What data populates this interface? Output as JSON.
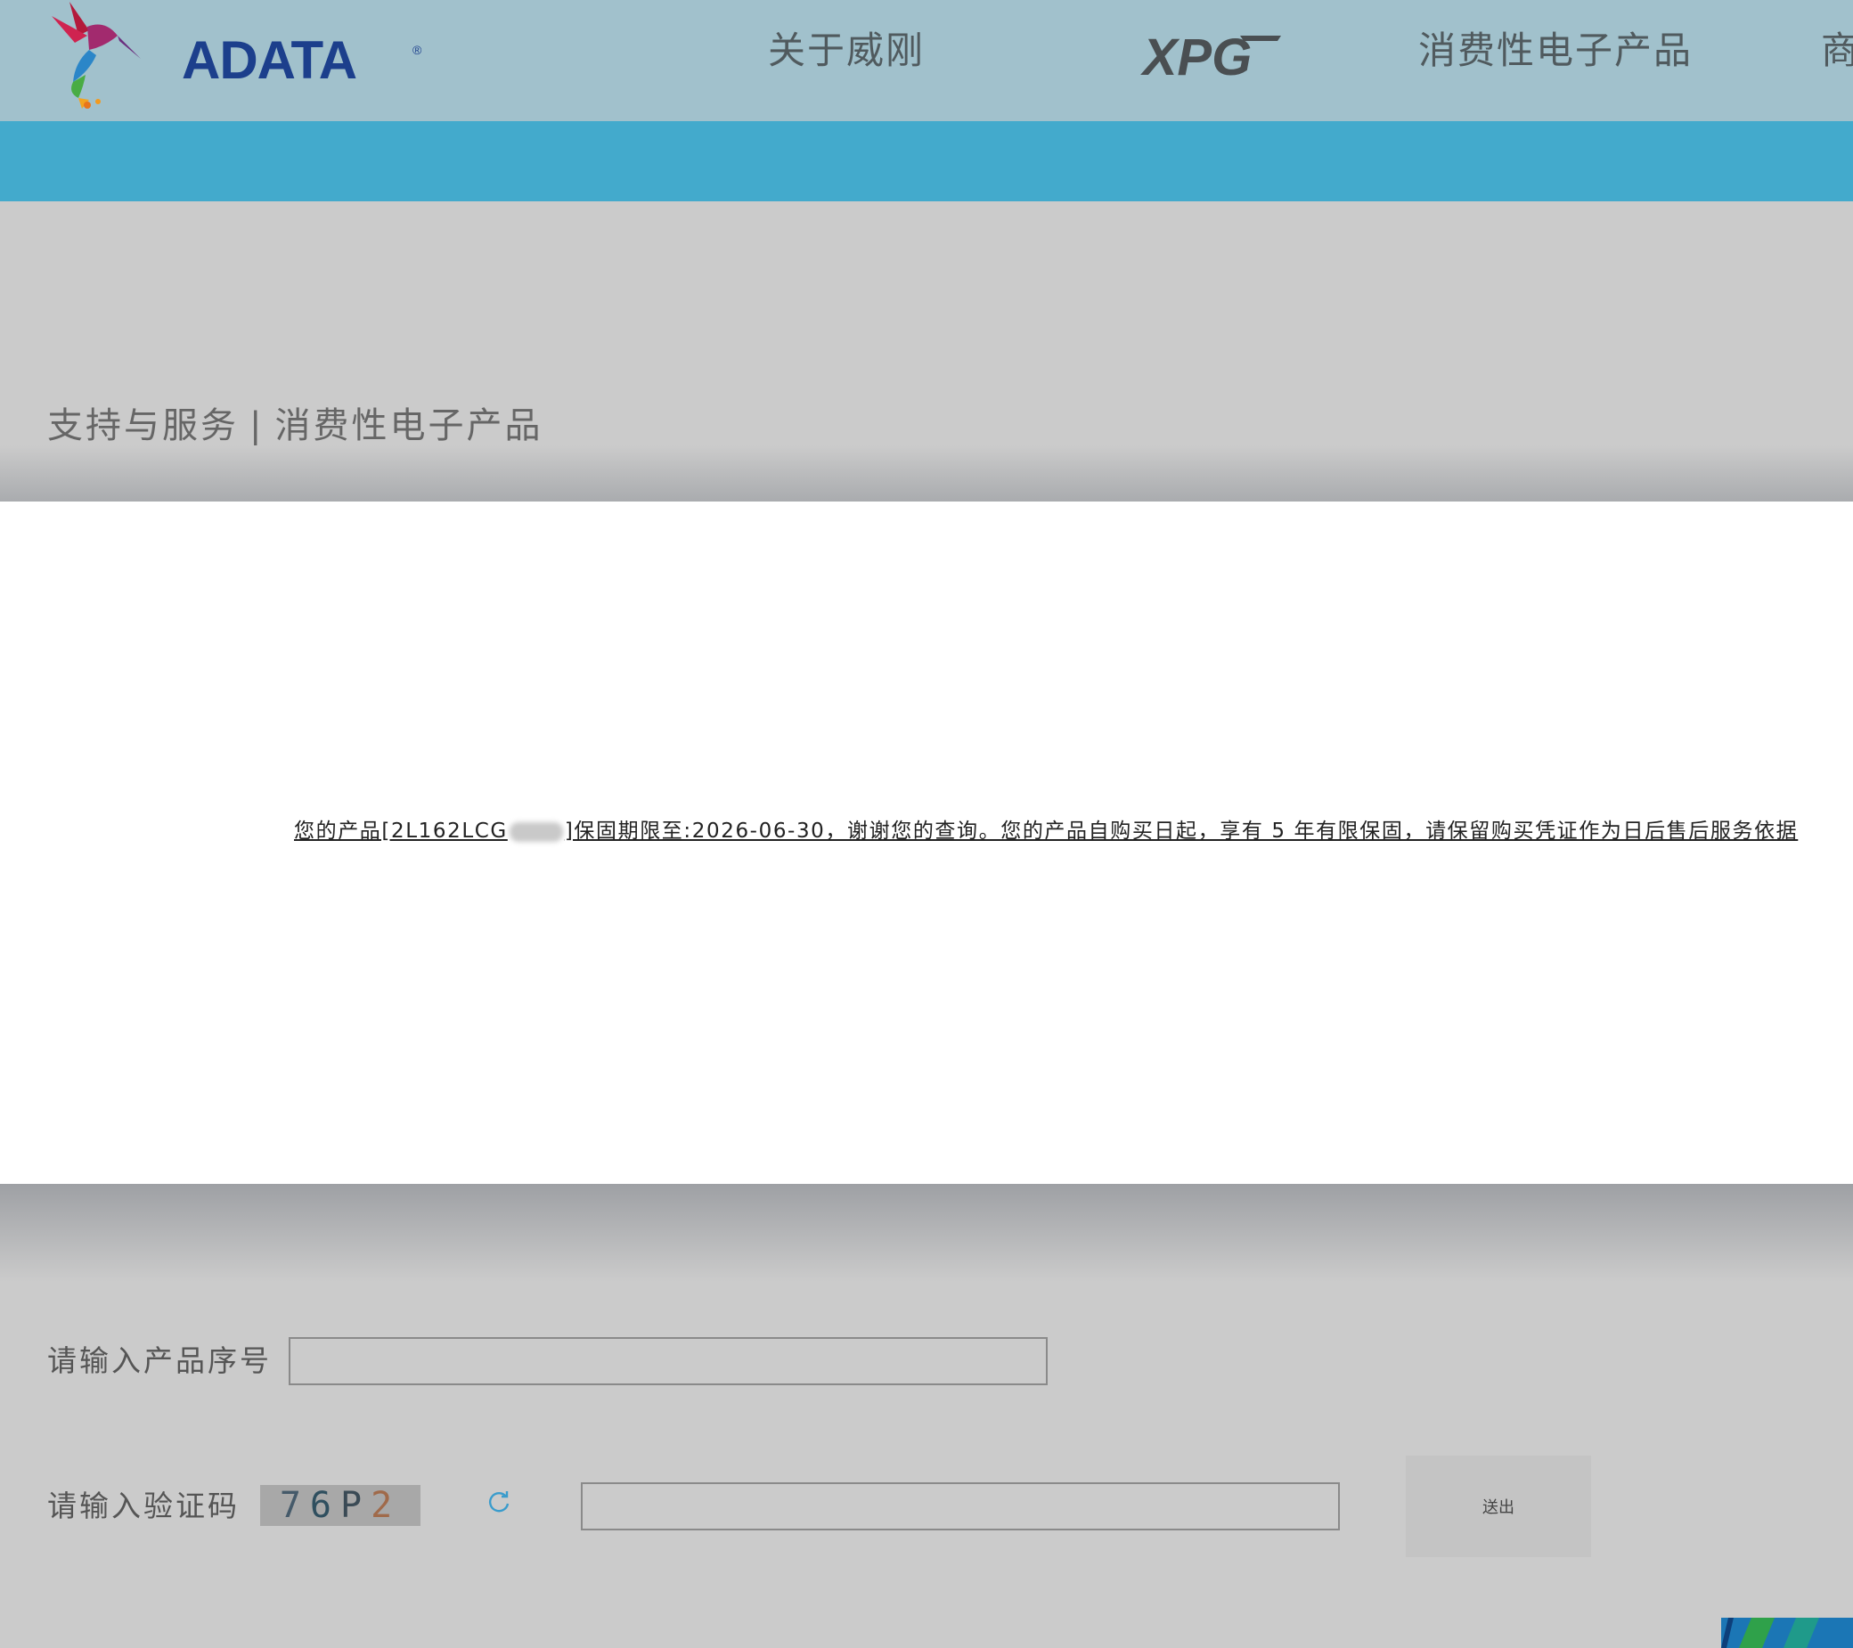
{
  "header": {
    "logo_text": "ADATA",
    "logo_reg": "®",
    "nav": [
      "关于威刚",
      "消费性电子产品",
      "商"
    ],
    "nav_xpg": "XPG"
  },
  "breadcrumb": {
    "section": "支持与服务",
    "separator": "|",
    "page": "消费性电子产品"
  },
  "modal": {
    "message_prefix": "您的产品[2L162LCG",
    "message_suffix": "]保固期限至:2026-06-30，谢谢您的查询。您的产品自购买日起，享有 5 年有限保固，请保留购买凭证作为日后售后服务依据"
  },
  "form": {
    "serial_label": "请输入产品序号",
    "serial_value": "",
    "captcha_label": "请输入验证码",
    "captcha_chars": [
      "7",
      "6",
      "P",
      "2"
    ],
    "captcha_value": "",
    "submit_label": "送出"
  },
  "colors": {
    "topbar": "#a1c1cc",
    "accent_bar": "#43aacc",
    "logo_blue": "#1c3f8c",
    "overlay": "#cbcbcb"
  }
}
